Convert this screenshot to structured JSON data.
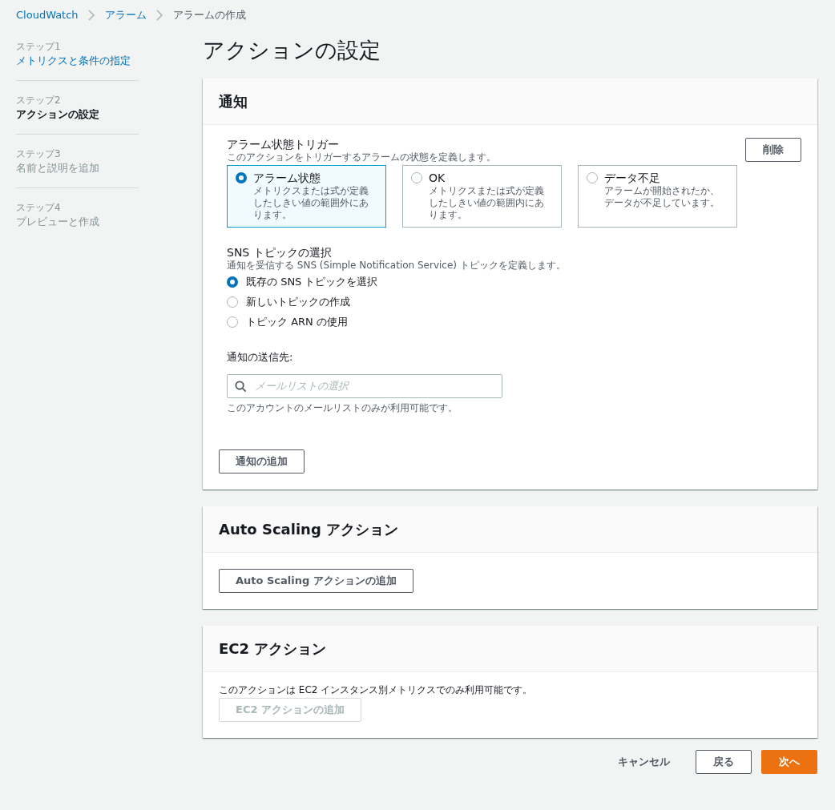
{
  "breadcrumb": [
    {
      "label": "CloudWatch",
      "link": true
    },
    {
      "label": "アラーム",
      "link": true
    },
    {
      "label": "アラームの作成",
      "link": false
    }
  ],
  "steps": [
    {
      "step": "ステップ1",
      "label": "メトリクスと条件の指定",
      "completed": true,
      "current": false
    },
    {
      "step": "ステップ2",
      "label": "アクションの設定",
      "completed": false,
      "current": true
    },
    {
      "step": "ステップ3",
      "label": "名前と説明を追加",
      "completed": false,
      "current": false
    },
    {
      "step": "ステップ4",
      "label": "プレビューと作成",
      "completed": false,
      "current": false
    }
  ],
  "page_title": "アクションの設定",
  "notification": {
    "title": "通知",
    "remove_button": "削除",
    "trigger_label": "アラーム状態トリガー",
    "trigger_description": "このアクションをトリガーするアラームの状態を定義します。",
    "trigger_options": [
      {
        "label": "アラーム状態",
        "description": "メトリクスまたは式が定義したしきい値の範囲外にあります。",
        "selected": true
      },
      {
        "label": "OK",
        "description": "メトリクスまたは式が定義したしきい値の範囲内にあります。",
        "selected": false
      },
      {
        "label": "データ不足",
        "description": "アラームが開始されたか、データが不足しています。",
        "selected": false
      }
    ],
    "sns_label": "SNS トピックの選択",
    "sns_description": "通知を受信する SNS (Simple Notification Service) トピックを定義します。",
    "sns_options": [
      {
        "label": "既存の SNS トピックを選択",
        "selected": true
      },
      {
        "label": "新しいトピックの作成",
        "selected": false
      },
      {
        "label": "トピック ARN の使用",
        "selected": false
      }
    ],
    "recipient_label": "通知の送信先:",
    "recipient_placeholder": "メールリストの選択",
    "recipient_hint": "このアカウントのメールリストのみが利用可能です。",
    "add_button": "通知の追加"
  },
  "autoscaling": {
    "title": "Auto Scaling アクション",
    "add_button": "Auto Scaling アクションの追加",
    "disabled": false
  },
  "ec2": {
    "title": "EC2 アクション",
    "note": "このアクションは EC2 インスタンス別メトリクスでのみ利用可能です。",
    "add_button": "EC2 アクションの追加",
    "disabled": true
  },
  "footer_buttons": [
    {
      "label": "キャンセル",
      "kind": "link"
    },
    {
      "label": "戻る",
      "kind": "normal"
    },
    {
      "label": "次へ",
      "kind": "primary"
    }
  ]
}
